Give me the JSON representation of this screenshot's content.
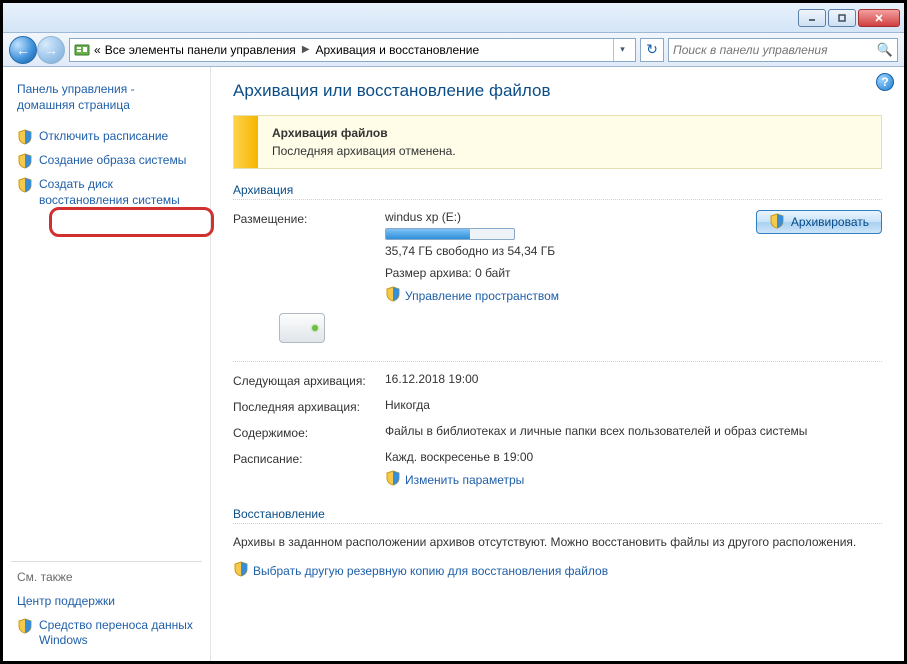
{
  "titlebar": {
    "minimize": "",
    "maximize": "",
    "close": ""
  },
  "breadcrumb": {
    "b1": "Все элементы панели управления",
    "b2": "Архивация и восстановление",
    "lead": "«"
  },
  "search": {
    "placeholder": "Поиск в панели управления"
  },
  "sidebar": {
    "home_line1": "Панель управления -",
    "home_line2": "домашняя страница",
    "items": [
      {
        "label": "Отключить расписание"
      },
      {
        "label": "Создание образа системы"
      },
      {
        "label": "Создать диск восстановления системы"
      }
    ],
    "see_also": "См. также",
    "support": "Центр поддержки",
    "transfer": "Средство переноса данных Windows"
  },
  "page": {
    "title": "Архивация или восстановление файлов"
  },
  "banner": {
    "title": "Архивация файлов",
    "subtitle": "Последняя архивация отменена."
  },
  "archive_section": {
    "head": "Архивация"
  },
  "location": {
    "label": "Размещение:",
    "drive": "windus xp (E:)",
    "free": "35,74 ГБ свободно из 54,34 ГБ",
    "size": "Размер архива: 0 байт",
    "manage": "Управление пространством"
  },
  "backup_btn": "Архивировать",
  "schedule": {
    "next_label": "Следующая архивация:",
    "next_value": "16.12.2018 19:00",
    "last_label": "Последняя архивация:",
    "last_value": "Никогда",
    "content_label": "Содержимое:",
    "content_value": "Файлы в библиотеках и личные папки всех пользователей и образ системы",
    "sched_label": "Расписание:",
    "sched_value": "Кажд. воскресенье в 19:00",
    "change": "Изменить параметры"
  },
  "restore": {
    "head": "Восстановление",
    "text": "Архивы в заданном расположении архивов отсутствуют. Можно восстановить файлы из другого расположения.",
    "link": "Выбрать другую резервную копию для восстановления файлов"
  }
}
